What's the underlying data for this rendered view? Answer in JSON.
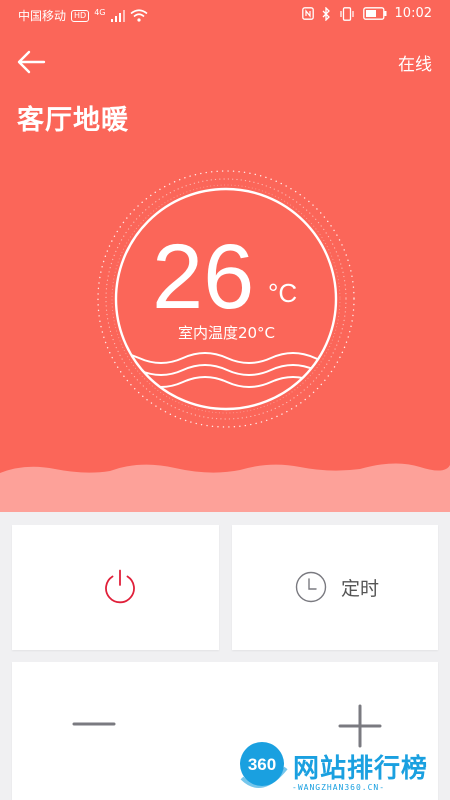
{
  "status_bar": {
    "carrier": "中国移动",
    "hd": "HD",
    "network": "4G",
    "time": "10:02",
    "icons": [
      "signal-icon",
      "wifi-icon",
      "nfc-icon",
      "bluetooth-icon",
      "vibrate-icon",
      "battery-icon"
    ]
  },
  "header": {
    "back_icon": "arrow-left-icon",
    "status": "在线",
    "title": "客厅地暖"
  },
  "thermostat": {
    "set_temperature": "26",
    "unit": "°C",
    "indoor_label": "室内温度20°C"
  },
  "controls": {
    "power_icon": "power-icon",
    "timer_icon": "clock-icon",
    "timer_label": "定时",
    "decrease_icon": "minus-icon",
    "increase_icon": "plus-icon"
  },
  "watermark": {
    "logo_number": "360",
    "text": "网站排行榜",
    "sub": "-WANGZHAN360.CN-"
  },
  "colors": {
    "primary": "#fb6659",
    "wave": "#fda199",
    "power": "#e0203a",
    "icon_gray": "#7a7a80",
    "watermark": "#1aa0e0"
  }
}
